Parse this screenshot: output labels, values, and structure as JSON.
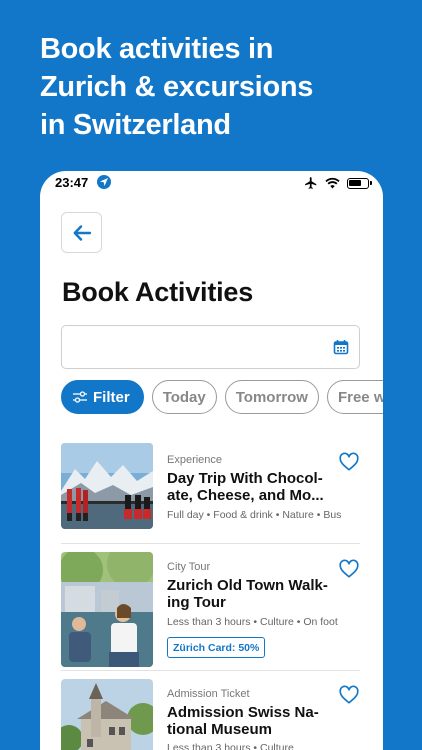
{
  "headline": {
    "line1": "Book activities in",
    "line2": "Zurich & excursions",
    "line3": "in Switzerland"
  },
  "status_bar": {
    "time": "23:47",
    "icons": [
      "location-arrow-icon",
      "airplane-icon",
      "wifi-icon",
      "battery-icon"
    ]
  },
  "page": {
    "title": "Book Activities",
    "back_icon": "arrow-left-icon"
  },
  "date_field": {
    "value": "",
    "placeholder": "",
    "icon": "calendar-icon"
  },
  "filters": {
    "filter_label": "Filter",
    "chips": [
      "Today",
      "Tomorrow",
      "Free wi"
    ]
  },
  "activities": [
    {
      "category": "Experience",
      "title_line1": "Day Trip With Chocol-",
      "title_line2": "ate, Cheese, and Mo...",
      "meta": "Full day • Food & drink • Nature • Bus",
      "badge": ""
    },
    {
      "category": "City Tour",
      "title_line1": "Zurich Old Town Walk-",
      "title_line2": "ing Tour",
      "meta": "Less than 3 hours • Culture • On foot",
      "badge": "Zürich Card: 50%"
    },
    {
      "category": "Admission Ticket",
      "title_line1": "Admission Swiss Na-",
      "title_line2": "tional Museum",
      "meta": "Less than 3 hours • Culture",
      "badge": ""
    }
  ],
  "colors": {
    "brand": "#1277c8",
    "text": "#111111",
    "muted": "#777777"
  }
}
